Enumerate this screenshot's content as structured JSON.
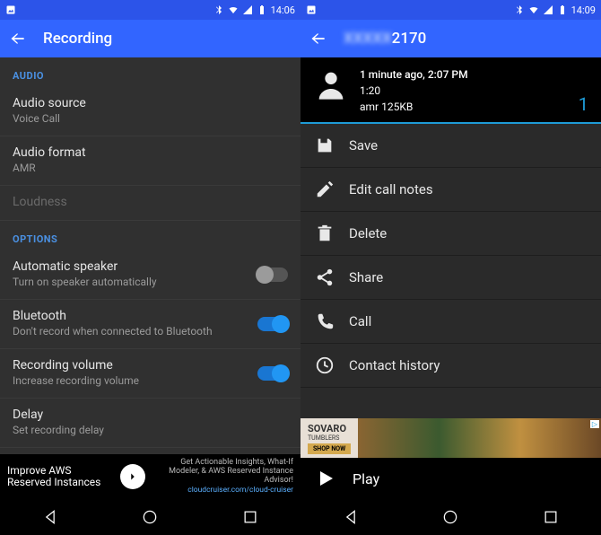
{
  "left": {
    "status": {
      "time": "14:06"
    },
    "appbar": {
      "title": "Recording"
    },
    "audio_header": "AUDIO",
    "audio_source": {
      "title": "Audio source",
      "sub": "Voice Call"
    },
    "audio_format": {
      "title": "Audio format",
      "sub": "AMR"
    },
    "loudness": {
      "title": "Loudness"
    },
    "options_header": "OPTIONS",
    "auto_speaker": {
      "title": "Automatic speaker",
      "sub": "Turn on speaker automatically"
    },
    "bluetooth": {
      "title": "Bluetooth",
      "sub": "Don't record when connected to Bluetooth"
    },
    "rec_volume": {
      "title": "Recording volume",
      "sub": "Increase recording volume"
    },
    "delay": {
      "title": "Delay",
      "sub": "Set recording delay"
    },
    "ad": {
      "title": "Improve AWS Reserved Instances",
      "desc": "Get Actionable Insights, What-If Modeler, & AWS Reserved Instance Advisor!",
      "link": "cloudcruiser.com/cloud-cruiser"
    }
  },
  "right": {
    "status": {
      "time": "14:09"
    },
    "appbar": {
      "title_hidden": "XXXXX",
      "title_suffix": "2170"
    },
    "call": {
      "time": "1 minute ago, 2:07 PM",
      "duration": "1:20",
      "fileinfo": "amr 125KB",
      "count": "1"
    },
    "menu": {
      "save": "Save",
      "edit": "Edit call notes",
      "delete": "Delete",
      "share": "Share",
      "call": "Call",
      "history": "Contact history"
    },
    "ad": {
      "brand": "SOVARO",
      "brand_sub": "TUMBLERS",
      "cta": "SHOP NOW"
    },
    "play": "Play"
  }
}
